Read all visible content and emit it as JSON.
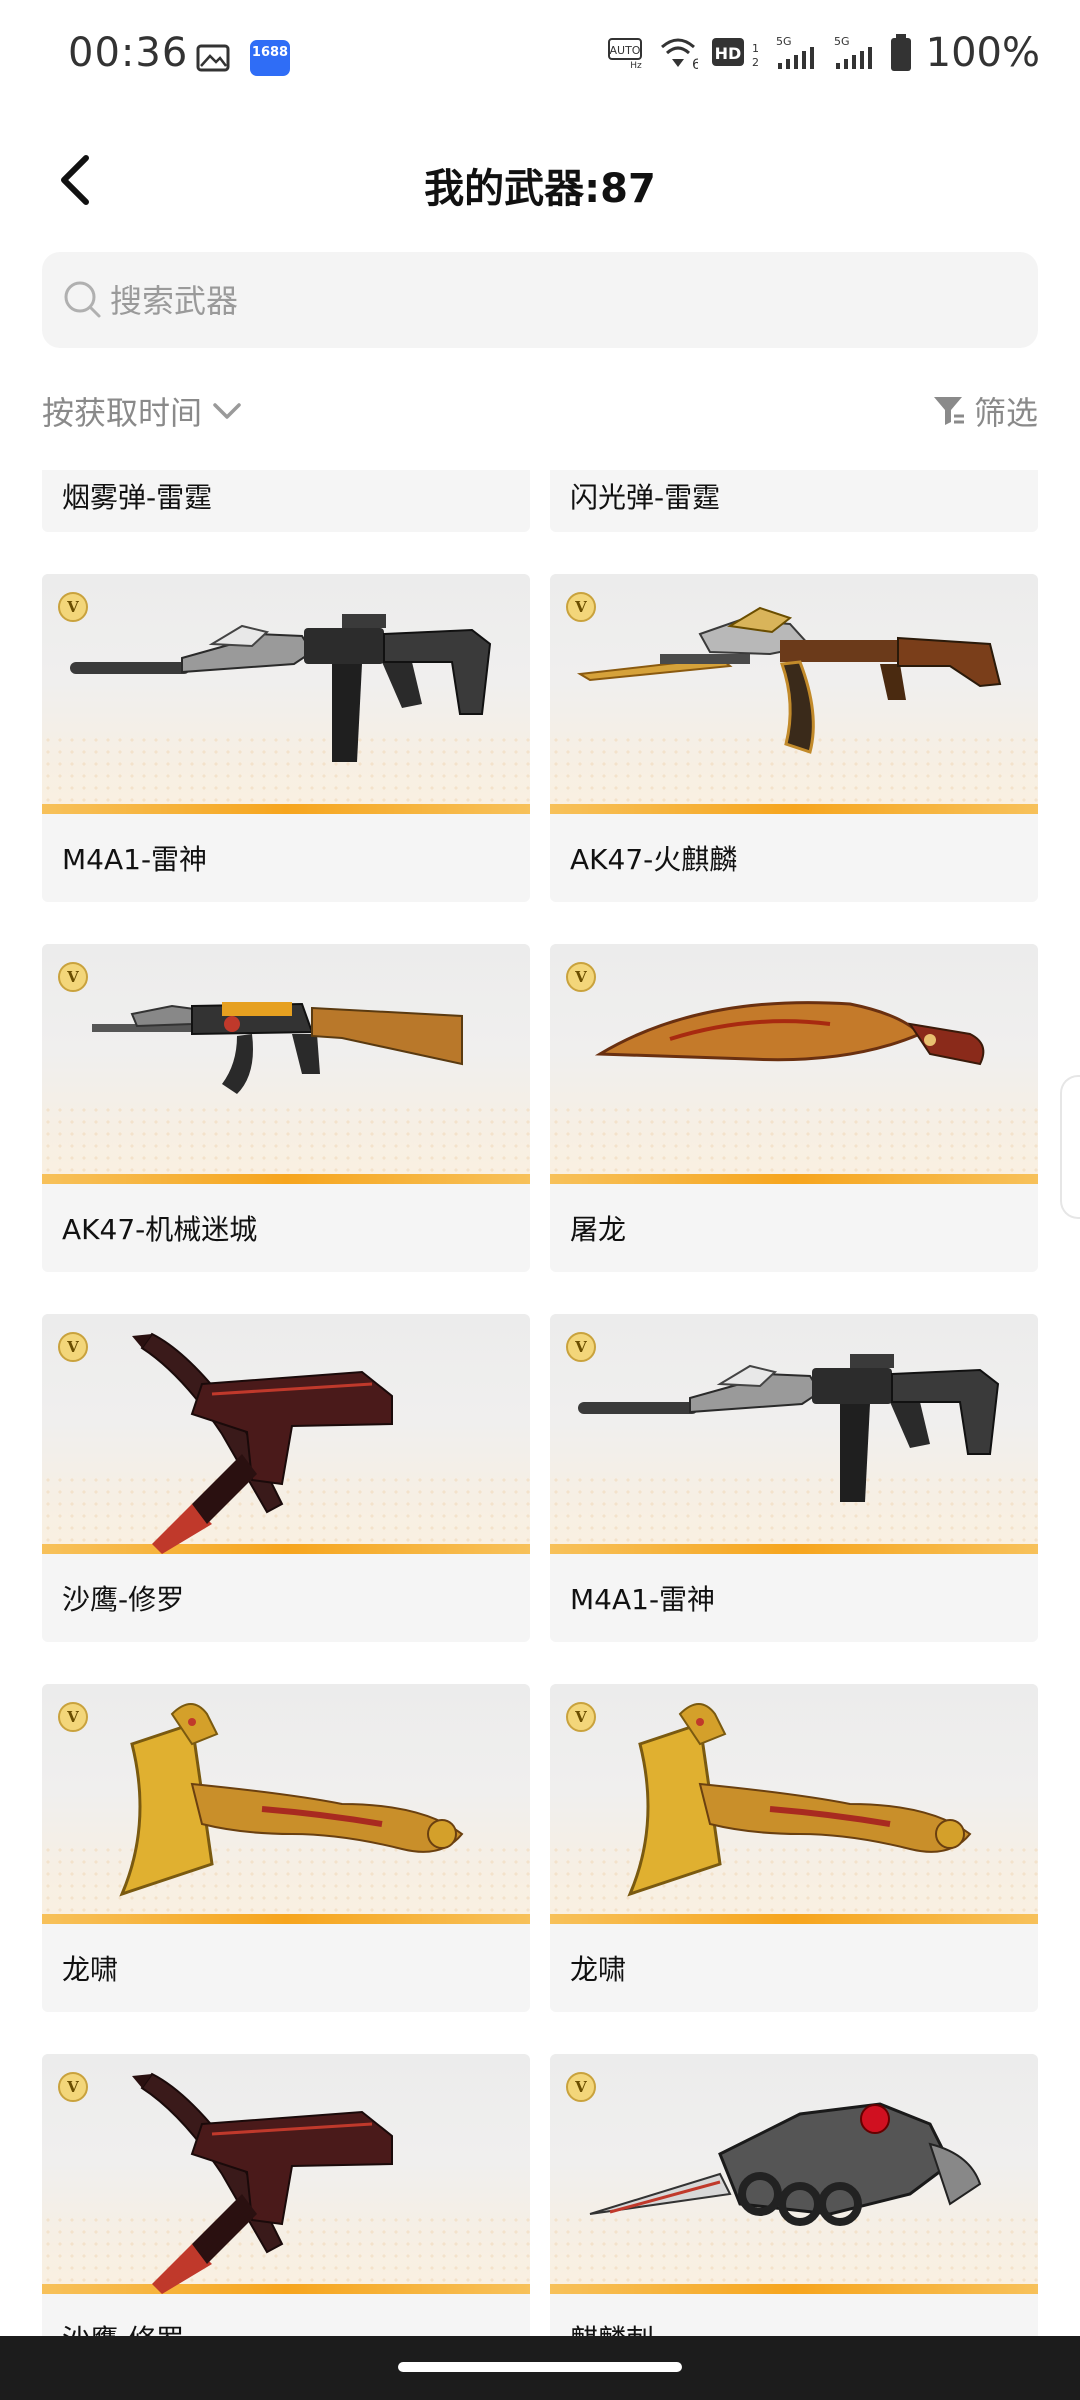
{
  "status_bar": {
    "time": "00:36",
    "app_badge": "1688",
    "battery": "100%",
    "icons": [
      "gallery-icon",
      "app-1688-icon",
      "auto-hz-icon",
      "wifi-6-icon",
      "hd-icon",
      "signal-5g-icon",
      "signal-5g-icon",
      "battery-icon"
    ]
  },
  "header": {
    "title": "我的武器:87",
    "back_icon": "chevron-left-icon"
  },
  "search": {
    "placeholder": "搜索武器",
    "value": ""
  },
  "sort": {
    "label": "按获取时间",
    "filter_label": "筛选"
  },
  "weapons": [
    {
      "name": "烟雾弹-雷霆",
      "art": "none"
    },
    {
      "name": "闪光弹-雷霆",
      "art": "none"
    },
    {
      "name": "M4A1-雷神",
      "art": "rifle-m4"
    },
    {
      "name": "AK47-火麒麟",
      "art": "rifle-ak-gold"
    },
    {
      "name": "AK47-机械迷城",
      "art": "rifle-ak-wood"
    },
    {
      "name": "屠龙",
      "art": "kukri"
    },
    {
      "name": "沙鹰-修罗",
      "art": "pistol-blade"
    },
    {
      "name": "M4A1-雷神",
      "art": "rifle-m4"
    },
    {
      "name": "龙啸",
      "art": "dragon-axe"
    },
    {
      "name": "龙啸",
      "art": "dragon-axe"
    },
    {
      "name": "沙鹰-修罗",
      "art": "pistol-blade"
    },
    {
      "name": "麒麟刺",
      "art": "knuckle-blade"
    }
  ],
  "colors": {
    "accent_stripe": "#f6a51e",
    "card_bg": "#f5f5f5",
    "badge_gold": "#f3d67a"
  }
}
